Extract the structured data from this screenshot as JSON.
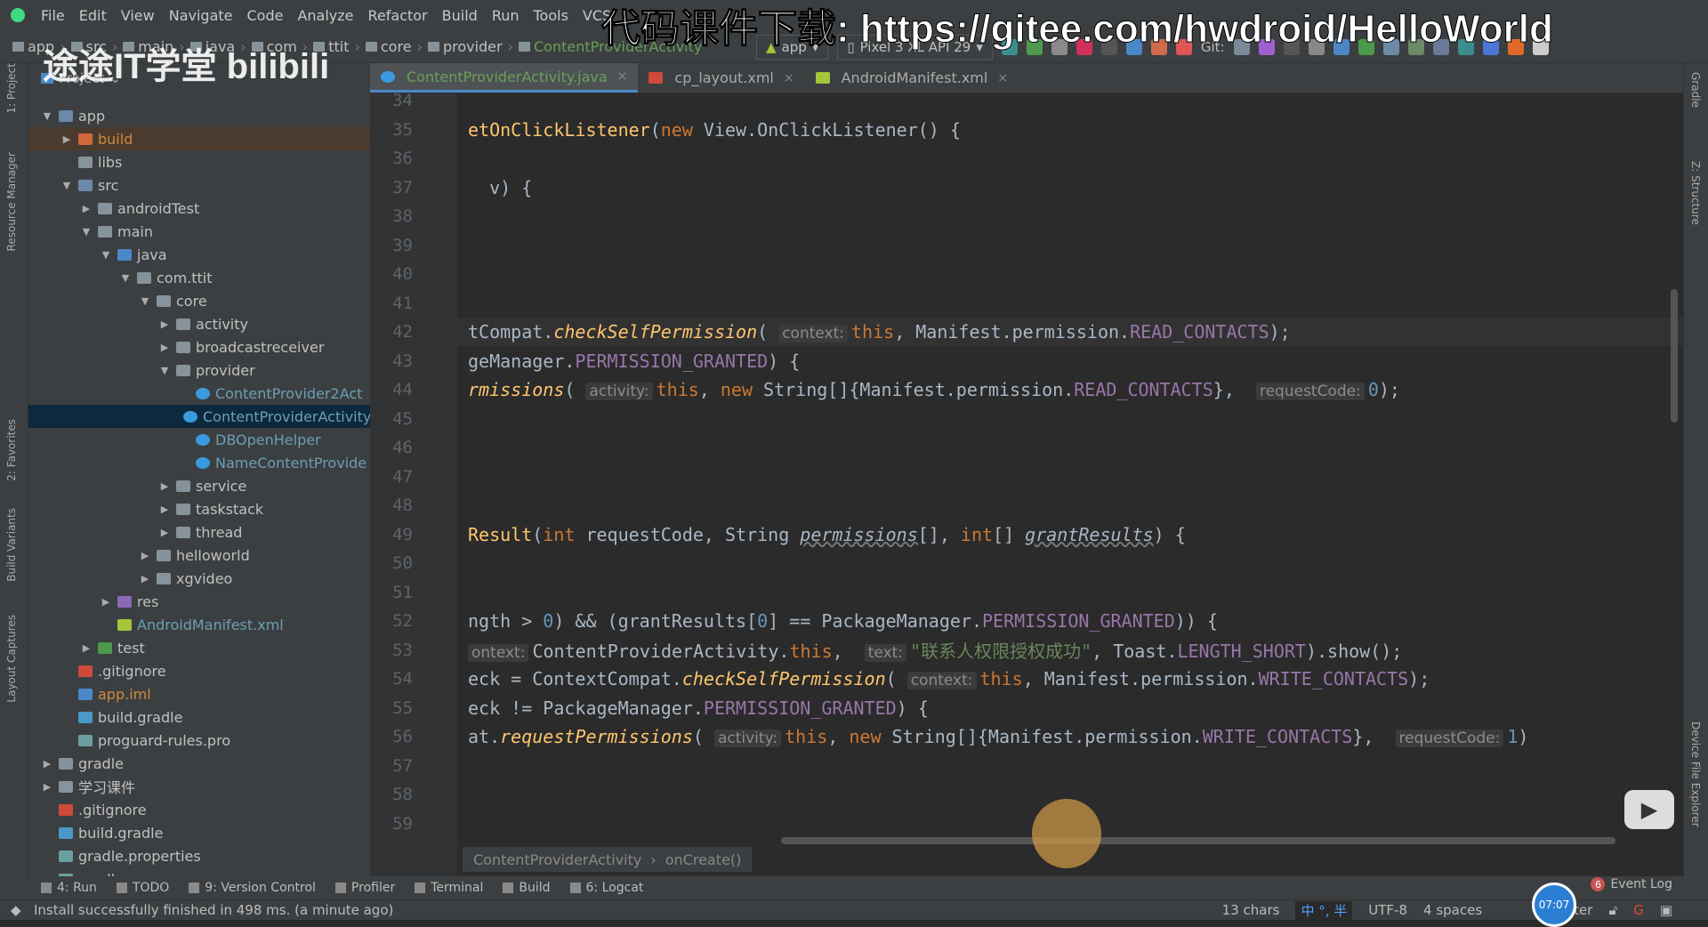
{
  "menu": [
    "File",
    "Edit",
    "View",
    "Navigate",
    "Code",
    "Analyze",
    "Refactor",
    "Build",
    "Run",
    "Tools",
    "VCS"
  ],
  "breadcrumbs": [
    "app",
    "src",
    "main",
    "java",
    "com",
    "ttit",
    "core",
    "provider",
    "ContentProviderActivity"
  ],
  "toolbar": {
    "config": "app",
    "device": "Pixel 3 XL API 29",
    "git_label": "Git:"
  },
  "project_panel": {
    "title": "Project",
    "dropdown": "Project"
  },
  "tree": [
    {
      "d": 0,
      "a": "open",
      "i": "module",
      "label": "app"
    },
    {
      "d": 1,
      "a": "closed",
      "i": "folder-orange",
      "label": "build",
      "c": "#d08a3a",
      "hl": true
    },
    {
      "d": 1,
      "a": "",
      "i": "folder",
      "label": "libs"
    },
    {
      "d": 1,
      "a": "open",
      "i": "folder-src",
      "label": "src"
    },
    {
      "d": 2,
      "a": "closed",
      "i": "folder",
      "label": "androidTest"
    },
    {
      "d": 2,
      "a": "open",
      "i": "folder",
      "label": "main"
    },
    {
      "d": 3,
      "a": "open",
      "i": "folder-blue",
      "label": "java"
    },
    {
      "d": 4,
      "a": "open",
      "i": "package",
      "label": "com.ttit"
    },
    {
      "d": 5,
      "a": "open",
      "i": "package",
      "label": "core"
    },
    {
      "d": 6,
      "a": "closed",
      "i": "package",
      "label": "activity"
    },
    {
      "d": 6,
      "a": "closed",
      "i": "package",
      "label": "broadcastreceiver"
    },
    {
      "d": 6,
      "a": "open",
      "i": "package",
      "label": "provider"
    },
    {
      "d": 7,
      "a": "",
      "i": "class",
      "label": "ContentProvider2Act",
      "c": "#6a9fb5"
    },
    {
      "d": 7,
      "a": "",
      "i": "class",
      "label": "ContentProviderActivity",
      "c": "#6a9fb5",
      "sel": true
    },
    {
      "d": 7,
      "a": "",
      "i": "class",
      "label": "DBOpenHelper",
      "c": "#6a9fb5"
    },
    {
      "d": 7,
      "a": "",
      "i": "class",
      "label": "NameContentProvide",
      "c": "#6a9fb5"
    },
    {
      "d": 6,
      "a": "closed",
      "i": "package",
      "label": "service"
    },
    {
      "d": 6,
      "a": "closed",
      "i": "package",
      "label": "taskstack"
    },
    {
      "d": 6,
      "a": "closed",
      "i": "package",
      "label": "thread"
    },
    {
      "d": 5,
      "a": "closed",
      "i": "package",
      "label": "helloworld"
    },
    {
      "d": 5,
      "a": "closed",
      "i": "package",
      "label": "xgvideo"
    },
    {
      "d": 3,
      "a": "closed",
      "i": "folder-res",
      "label": "res"
    },
    {
      "d": 3,
      "a": "",
      "i": "android",
      "label": "AndroidManifest.xml",
      "c": "#6a9fb5"
    },
    {
      "d": 2,
      "a": "closed",
      "i": "folder-green",
      "label": "test"
    },
    {
      "d": 1,
      "a": "",
      "i": "git",
      "label": ".gitignore"
    },
    {
      "d": 1,
      "a": "",
      "i": "iml",
      "label": "app.iml",
      "c": "#d08a3a"
    },
    {
      "d": 1,
      "a": "",
      "i": "gradle",
      "label": "build.gradle"
    },
    {
      "d": 1,
      "a": "",
      "i": "file",
      "label": "proguard-rules.pro"
    },
    {
      "d": 0,
      "a": "closed",
      "i": "folder",
      "label": "gradle"
    },
    {
      "d": 0,
      "a": "closed",
      "i": "folder",
      "label": "学习课件"
    },
    {
      "d": 0,
      "a": "",
      "i": "git",
      "label": ".gitignore"
    },
    {
      "d": 0,
      "a": "",
      "i": "gradle",
      "label": "build.gradle"
    },
    {
      "d": 0,
      "a": "",
      "i": "xml",
      "label": "gradle.properties"
    },
    {
      "d": 0,
      "a": "",
      "i": "file",
      "label": "gradlew"
    }
  ],
  "tabs": [
    {
      "label": "ContentProviderActivity.java",
      "active": true,
      "icon": "class-icon"
    },
    {
      "label": "cp_layout.xml",
      "icon": "layout-icon"
    },
    {
      "label": "AndroidManifest.xml",
      "icon": "android-icon"
    }
  ],
  "code": [
    {
      "n": "34",
      "t": []
    },
    {
      "n": "35",
      "t": [
        [
          "etOnClickListener",
          "fn"
        ],
        [
          "(",
          ""
        ],
        [
          "new",
          "kw"
        ],
        [
          " View.OnClickListener() {",
          ""
        ]
      ]
    },
    {
      "n": "36",
      "t": []
    },
    {
      "n": "37",
      "t": [
        [
          "  v) {",
          ""
        ]
      ]
    },
    {
      "n": "38",
      "t": []
    },
    {
      "n": "39",
      "t": []
    },
    {
      "n": "40",
      "t": []
    },
    {
      "n": "41",
      "t": []
    },
    {
      "n": "42",
      "cur": true,
      "t": [
        [
          "tCompat.",
          ""
        ],
        [
          "checkSelfPermission",
          "fni"
        ],
        [
          "( ",
          ""
        ],
        [
          "context:",
          "hint"
        ],
        [
          "this",
          "kw"
        ],
        [
          ", Manifest.permission.",
          ""
        ],
        [
          "READ_CONTACTS",
          "cst"
        ],
        [
          ");",
          ""
        ]
      ]
    },
    {
      "n": "43",
      "t": [
        [
          "geManager.",
          ""
        ],
        [
          "PERMISSION_GRANTED",
          "cst"
        ],
        [
          ") {",
          ""
        ]
      ]
    },
    {
      "n": "44",
      "t": [
        [
          "rmissions",
          "fni"
        ],
        [
          "( ",
          ""
        ],
        [
          "activity:",
          "hint"
        ],
        [
          "this",
          "kw"
        ],
        [
          ", ",
          ""
        ],
        [
          "new",
          "kw"
        ],
        [
          " String[]{Manifest.permission.",
          ""
        ],
        [
          "READ_CONTACTS",
          "cst"
        ],
        [
          "},  ",
          ""
        ],
        [
          "requestCode:",
          "hint"
        ],
        [
          "0",
          "num"
        ],
        [
          ");",
          ""
        ]
      ]
    },
    {
      "n": "45",
      "t": []
    },
    {
      "n": "46",
      "t": []
    },
    {
      "n": "47",
      "t": []
    },
    {
      "n": "48",
      "t": []
    },
    {
      "n": "49",
      "t": [
        [
          "Result",
          "fn"
        ],
        [
          "(",
          ""
        ],
        [
          "int",
          "kw"
        ],
        [
          " requestCode, String ",
          ""
        ],
        [
          "permissions",
          "pi"
        ],
        [
          "[], ",
          ""
        ],
        [
          "int",
          "kw"
        ],
        [
          "[] ",
          ""
        ],
        [
          "grantResults",
          "pi"
        ],
        [
          ") {",
          ""
        ]
      ]
    },
    {
      "n": "50",
      "t": []
    },
    {
      "n": "51",
      "t": []
    },
    {
      "n": "52",
      "t": [
        [
          "ngth > ",
          ""
        ],
        [
          "0",
          "num"
        ],
        [
          ") && (grantResults[",
          ""
        ],
        [
          "0",
          "num"
        ],
        [
          "] == PackageManager.",
          ""
        ],
        [
          "PERMISSION_GRANTED",
          "cst"
        ],
        [
          ")) {",
          ""
        ]
      ]
    },
    {
      "n": "53",
      "t": [
        [
          "ontext:",
          "hint"
        ],
        [
          "ContentProviderActivity.",
          ""
        ],
        [
          "this",
          "kw"
        ],
        [
          ",  ",
          ""
        ],
        [
          "text:",
          "hint"
        ],
        [
          "\"联系人权限授权成功\"",
          "str"
        ],
        [
          ", Toast.",
          ""
        ],
        [
          "LENGTH_SHORT",
          "cst"
        ],
        [
          ").show();",
          ""
        ]
      ]
    },
    {
      "n": "54",
      "t": [
        [
          "eck = ContextCompat.",
          ""
        ],
        [
          "checkSelfPermission",
          "fni"
        ],
        [
          "( ",
          ""
        ],
        [
          "context:",
          "hint"
        ],
        [
          "this",
          "kw"
        ],
        [
          ", Manifest.permission.",
          ""
        ],
        [
          "WRITE_CONTACTS",
          "cst"
        ],
        [
          ");",
          ""
        ]
      ]
    },
    {
      "n": "55",
      "t": [
        [
          "eck != PackageManager.",
          ""
        ],
        [
          "PERMISSION_GRANTED",
          "cst"
        ],
        [
          ") {",
          ""
        ]
      ]
    },
    {
      "n": "56",
      "t": [
        [
          "at.",
          ""
        ],
        [
          "requestPermissions",
          "fni"
        ],
        [
          "( ",
          ""
        ],
        [
          "activity:",
          "hint"
        ],
        [
          "this",
          "kw"
        ],
        [
          ", ",
          ""
        ],
        [
          "new",
          "kw"
        ],
        [
          " String[]{Manifest.permission.",
          ""
        ],
        [
          "WRITE_CONTACTS",
          "cst"
        ],
        [
          "},  ",
          ""
        ],
        [
          "requestCode:",
          "hint"
        ],
        [
          "1",
          "num"
        ],
        [
          ")",
          ""
        ]
      ]
    },
    {
      "n": "57",
      "t": []
    },
    {
      "n": "58",
      "t": []
    },
    {
      "n": "59",
      "t": []
    }
  ],
  "editor_breadcrumb": [
    "ContentProviderActivity",
    "onCreate()"
  ],
  "tool_windows": [
    "4: Run",
    "TODO",
    "9: Version Control",
    "Profiler",
    "Terminal",
    "Build",
    "6: Logcat"
  ],
  "left_stripe": [
    "1: Project",
    "Resource Manager",
    "2: Favorites",
    "Build Variants",
    "Layout Captures"
  ],
  "right_stripe": [
    "Gradle",
    "Z: Structure",
    "Device File Explorer"
  ],
  "status": {
    "message": "Install successfully finished in 498 ms. (a minute ago)",
    "chars": "13 chars",
    "ime": "中 °, 半",
    "encoding": "UTF-8",
    "indent": "4 spaces",
    "branch": "aster",
    "event_log": "Event Log",
    "event_count": "6",
    "clock": "07:07"
  },
  "watermark": {
    "top": "代码课件下载: https://gitee.com/hwdroid/HelloWorld",
    "logo": "途途IT学堂 bilibili"
  }
}
